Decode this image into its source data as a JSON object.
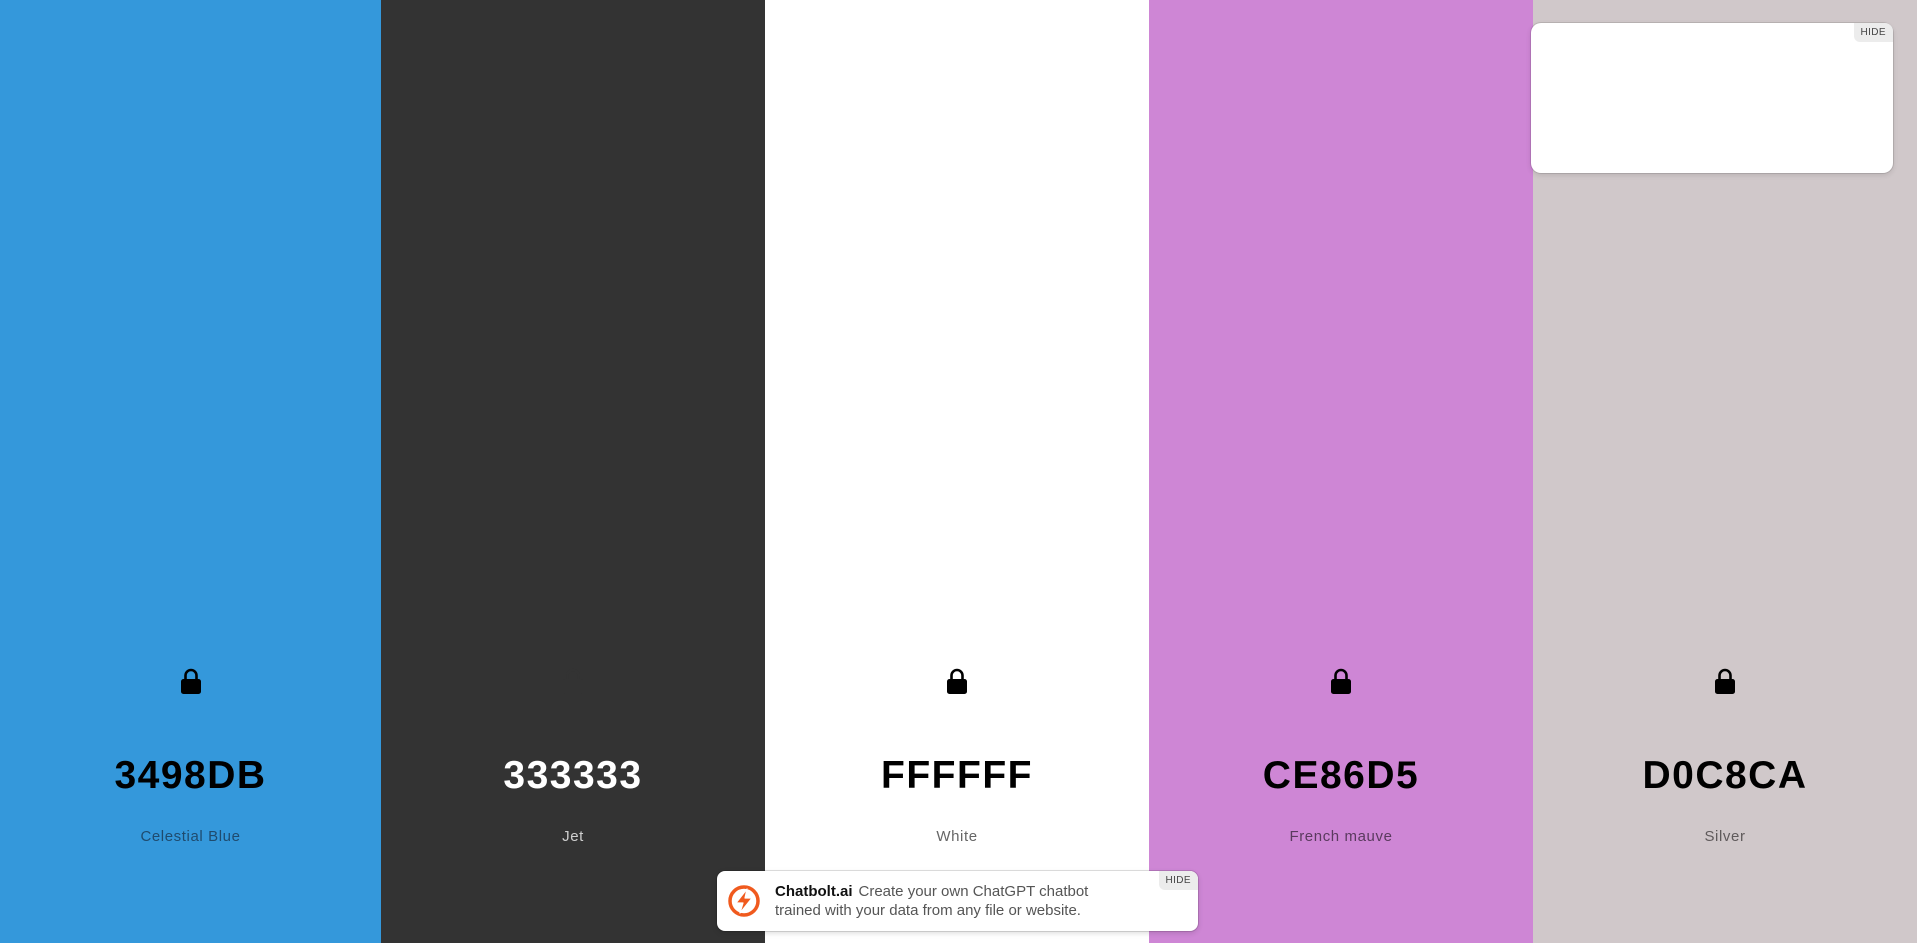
{
  "swatches": [
    {
      "hex": "3498DB",
      "name": "Celestial Blue",
      "color": "#3498db",
      "text_color": "#000000",
      "name_color": "#1f4b6e",
      "lock_color": "#000000",
      "locked": true,
      "width": 381
    },
    {
      "hex": "333333",
      "name": "Jet",
      "color": "#333333",
      "text_color": "#ffffff",
      "name_color": "#cfcfcf",
      "lock_color": "#333333",
      "locked": false,
      "width": 384
    },
    {
      "hex": "FFFFFF",
      "name": "White",
      "color": "#ffffff",
      "text_color": "#000000",
      "name_color": "#666666",
      "lock_color": "#000000",
      "locked": true,
      "width": 384
    },
    {
      "hex": "CE86D5",
      "name": "French mauve",
      "color": "#ce86d5",
      "text_color": "#000000",
      "name_color": "#5a3a5e",
      "lock_color": "#000000",
      "locked": true,
      "width": 384
    },
    {
      "hex": "D0C8CA",
      "name": "Silver",
      "color": "#d0c8ca",
      "text_color": "#000000",
      "name_color": "#5f5a5b",
      "lock_color": "#000000",
      "locked": true,
      "width": 384
    }
  ],
  "ad_card": {
    "hide_label": "HIDE"
  },
  "promo": {
    "brand": "Chatbolt.ai",
    "message": "Create your own ChatGPT chatbot trained with your data from any file or website.",
    "hide_label": "HIDE",
    "logo_icon": "lightning-bolt-icon",
    "accent": "#f05a1e"
  }
}
